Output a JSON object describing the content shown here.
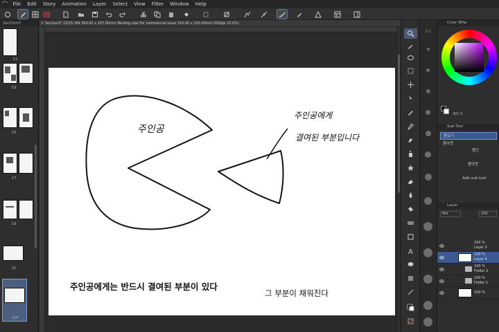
{
  "menubar": {
    "items": [
      "File",
      "Edit",
      "Story",
      "Animation",
      "Layer",
      "Select",
      "View",
      "Filter",
      "Window",
      "Help"
    ]
  },
  "document_tab": {
    "title": "Section2* 23/25 (B4 364.00 x 257.00mm Binding size For commercial issue 310.00 x 220.00mm 600dpi 22.0%)"
  },
  "page_panel": {
    "title": "Section5",
    "page_numbers": [
      "11",
      "13",
      "15",
      "17",
      "19",
      "21",
      "23*"
    ]
  },
  "drawing": {
    "hero_label": "주인공",
    "note_line1": "주인공에게",
    "note_line2": "결여된 부분입니다",
    "caption_main": "주인공에게는 반드시 결여된 부분이 있다",
    "caption_secondary": "그 부분이 채워진다"
  },
  "right_panel": {
    "color_header": "Color Whe",
    "color_values": "301 0",
    "subtool_header": "Sub Tool",
    "subtool_items": [
      "돋보기",
      "줌아웃",
      "줌인",
      "줌아웃"
    ],
    "subtool_selected": "돋보기",
    "subtool_hint": "줌아웃",
    "add_subtool": "Add sub tool",
    "layer_header": "Layer",
    "blend_mode": "Nor",
    "opacity": "100",
    "layers": [
      {
        "percent": "100 %",
        "name": "Layer 3",
        "kind": "raster",
        "selected": false
      },
      {
        "percent": "100 %",
        "name": "Layer 4",
        "kind": "raster",
        "selected": true
      },
      {
        "percent": "100 %",
        "name": "Folder 2",
        "kind": "folder",
        "selected": false
      },
      {
        "percent": "100 %",
        "name": "Folder 1",
        "kind": "folder",
        "selected": false
      },
      {
        "percent": "100 %",
        "name": "Paper",
        "kind": "paper",
        "selected": false
      }
    ]
  },
  "colors": {
    "accent": "#3b5a92",
    "panel_bg": "#2e2e2e",
    "canvas_bg": "#2c2a2c",
    "page": "#ffffff"
  }
}
